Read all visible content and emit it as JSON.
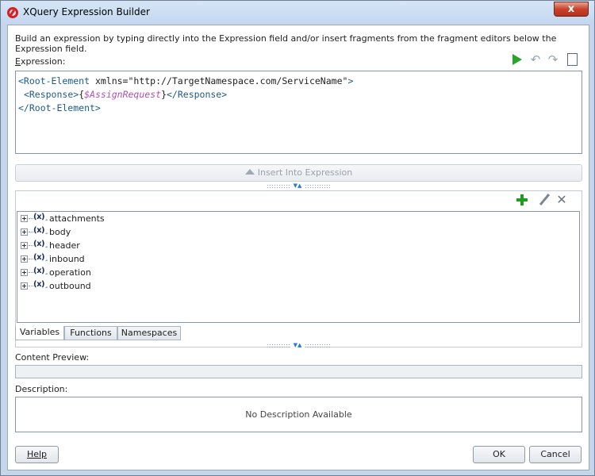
{
  "window": {
    "title": "XQuery Expression Builder",
    "close_label": "x"
  },
  "intro": "Build an expression by typing directly into the Expression field and/or insert fragments from the fragment editors below the Expression field.",
  "expression": {
    "label": "Expression:",
    "lines": [
      {
        "open": "<Root-Element",
        "attr": " xmlns=\"http://TargetNamespace.com/ServiceName\"",
        "close": ">"
      },
      {
        "indent": " ",
        "open": "<Response>",
        "brace_open": "{",
        "var": "$AssignRequest",
        "brace_close": "}",
        "end": "</Response>"
      },
      {
        "open": "</Root-Element>"
      }
    ],
    "toolbar": {
      "run_icon": "play-icon",
      "undo_icon": "undo-icon",
      "redo_icon": "redo-icon",
      "clear_icon": "new-document-icon"
    }
  },
  "insert_button": "Insert Into Expression",
  "fragment_tree": {
    "items": [
      "attachments",
      "body",
      "header",
      "inbound",
      "operation",
      "outbound"
    ]
  },
  "tabs": [
    "Variables",
    "Functions",
    "Namespaces"
  ],
  "content_preview_label": "Content Preview:",
  "description": {
    "label": "Description:",
    "text": "No Description Available"
  },
  "buttons": {
    "help": "Help",
    "ok": "OK",
    "cancel": "Cancel"
  },
  "colors": {
    "xml_tag": "#1e5a8a",
    "xquery_variable": "#b64db6",
    "run_green": "#2aa52a",
    "close_red": "#c8422b"
  }
}
